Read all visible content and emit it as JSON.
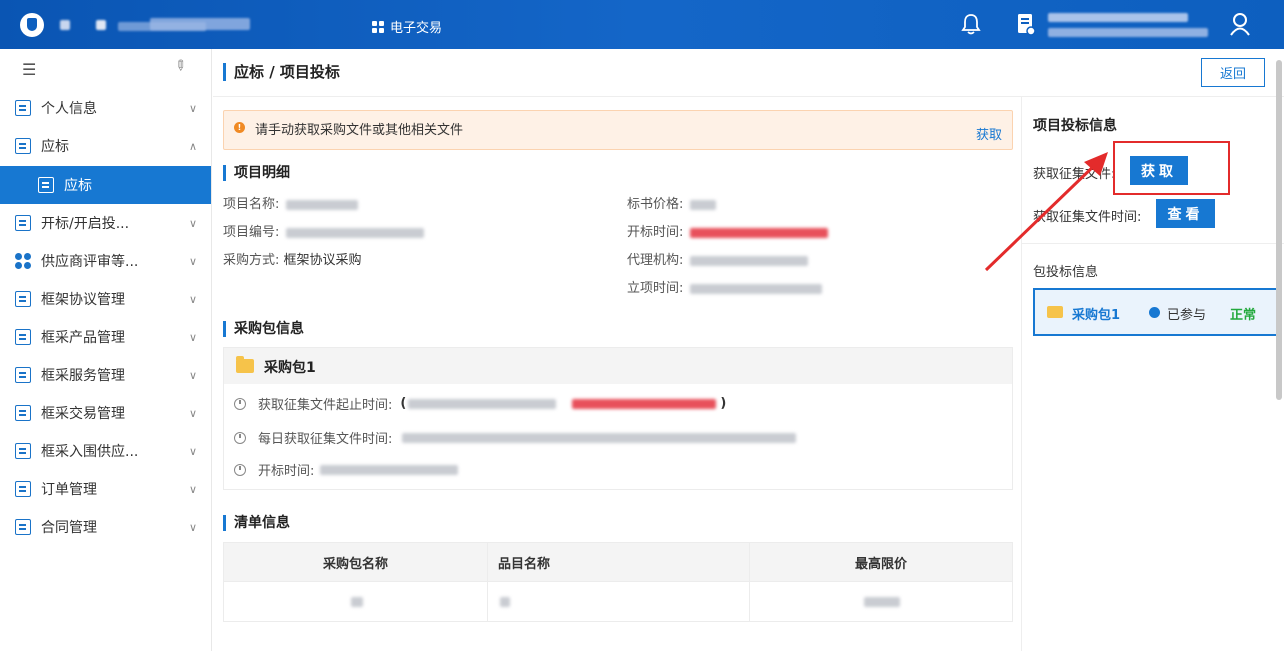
{
  "topbar": {
    "center_label": "电子交易",
    "icons": [
      "bell-icon",
      "document-icon",
      "user-icon"
    ],
    "bg_color": "#0d5fbf"
  },
  "sidebar": {
    "items": [
      {
        "label": "个人信息",
        "icon": "profile-icon"
      },
      {
        "label": "应标",
        "icon": "bid-icon",
        "expanded": true
      },
      {
        "label": "应标",
        "icon": "bid-icon",
        "active": true
      },
      {
        "label": "开标/开启投...",
        "icon": "bid-open-icon"
      },
      {
        "label": "供应商评审等...",
        "icon": "grid-icon"
      },
      {
        "label": "框架协议管理",
        "icon": "agreement-icon"
      },
      {
        "label": "框采产品管理",
        "icon": "product-icon"
      },
      {
        "label": "框采服务管理",
        "icon": "service-icon"
      },
      {
        "label": "框采交易管理",
        "icon": "trade-icon"
      },
      {
        "label": "框采入围供应...",
        "icon": "shortlist-icon"
      },
      {
        "label": "订单管理",
        "icon": "order-icon"
      },
      {
        "label": "合同管理",
        "icon": "contract-icon"
      }
    ]
  },
  "header": {
    "title": "应标 / 项目投标",
    "back_label": "返回"
  },
  "alert": {
    "text": "请手动获取采购文件或其他相关文件",
    "link": "获取"
  },
  "detail": {
    "title": "项目明细",
    "name_label": "项目名称:",
    "code_label": "项目编号:",
    "method_label": "采购方式:",
    "method_value": "框架协议采购",
    "price_label": "标书价格:",
    "open_time_label": "开标时间:",
    "agency_label": "代理机构:",
    "setup_time_label": "立项时间:"
  },
  "package_info": {
    "title": "采购包信息",
    "package_name": "采购包1",
    "fetch_period_label": "获取征集文件起止时间:",
    "daily_fetch_label": "每日获取征集文件时间:",
    "open_time_label": "开标时间:"
  },
  "list_info": {
    "title": "清单信息",
    "columns": [
      "采购包名称",
      "品目名称",
      "最高限价"
    ]
  },
  "right_panel": {
    "title": "项目投标信息",
    "fetch_label": "获取征集文件:",
    "fetch_button": "获取",
    "fetch_time_label": "获取征集文件时间:",
    "view_button": "查看",
    "package_section": "包投标信息",
    "package_name": "采购包1",
    "package_status": "已参与",
    "package_state": "正常"
  },
  "colors": {
    "accent": "#1778d2",
    "highlight_box": "#e32b2b",
    "success": "#23a93d"
  }
}
